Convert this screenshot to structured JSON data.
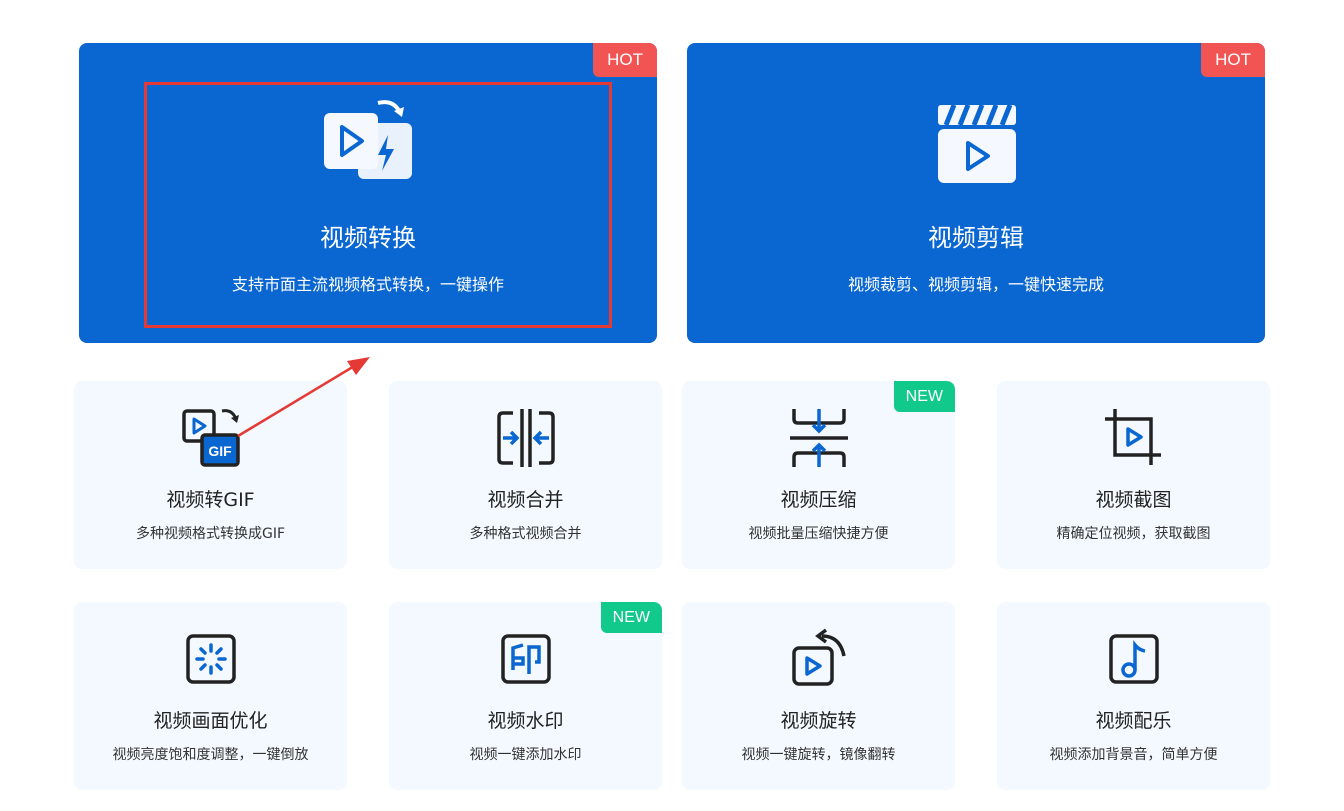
{
  "featured": [
    {
      "title": "视频转换",
      "desc": "支持市面主流视频格式转换，一键操作",
      "badge": "HOT",
      "icon": "video-convert-icon"
    },
    {
      "title": "视频剪辑",
      "desc": "视频裁剪、视频剪辑，一键快速完成",
      "badge": "HOT",
      "icon": "video-clapboard-icon"
    }
  ],
  "tools": [
    {
      "title": "视频转GIF",
      "desc": "多种视频格式转换成GIF",
      "badge": "",
      "icon": "video-to-gif-icon"
    },
    {
      "title": "视频合并",
      "desc": "多种格式视频合并",
      "badge": "",
      "icon": "merge-icon"
    },
    {
      "title": "视频压缩",
      "desc": "视频批量压缩快捷方便",
      "badge": "NEW",
      "icon": "compress-icon"
    },
    {
      "title": "视频截图",
      "desc": "精确定位视频，获取截图",
      "badge": "",
      "icon": "crop-icon"
    },
    {
      "title": "视频画面优化",
      "desc": "视频亮度饱和度调整，一键倒放",
      "badge": "",
      "icon": "enhance-icon"
    },
    {
      "title": "视频水印",
      "desc": "视频一键添加水印",
      "badge": "NEW",
      "icon": "watermark-icon"
    },
    {
      "title": "视频旋转",
      "desc": "视频一键旋转，镜像翻转",
      "badge": "",
      "icon": "rotate-icon"
    },
    {
      "title": "视频配乐",
      "desc": "视频添加背景音，简单方便",
      "badge": "",
      "icon": "music-icon"
    }
  ],
  "colors": {
    "primary": "#0a67d1",
    "hot": "#f25454",
    "new": "#12c98c",
    "card_bg": "#f3f9fe",
    "annotation": "#e53935"
  }
}
